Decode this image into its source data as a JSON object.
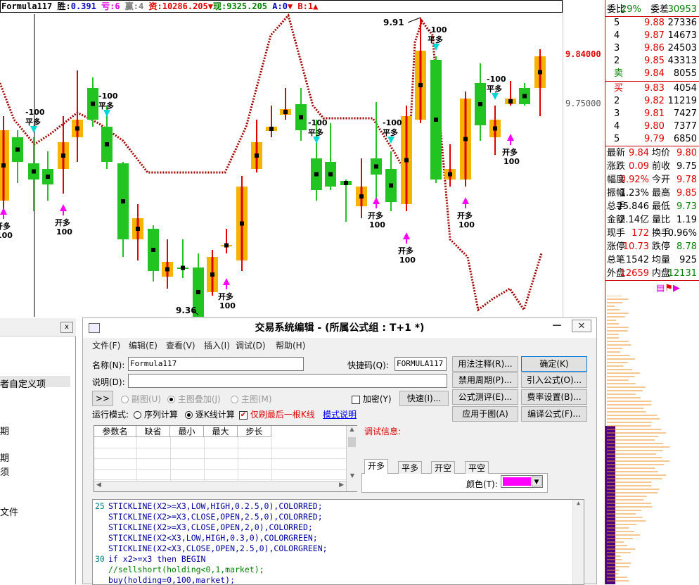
{
  "infobar": {
    "formula": "Formula117",
    "win_label": "胜:",
    "win_val": "0.391",
    "loss_label": "亏:",
    "loss_val": "6",
    "gain_label": "赢:",
    "gain_val": "4",
    "capital_label": "资:",
    "capital_val": "10286.205",
    "cash_label": "现:",
    "cash_val": "9325.205",
    "a_label": "A:",
    "a_val": "0",
    "b_label": "B:",
    "b_val": "1"
  },
  "chart": {
    "price_high_label": "9.84000",
    "price_mid_label": "9.75000",
    "peak_label": "9.91",
    "low_label": "9.36",
    "signals": [
      {
        "kind": "sell",
        "line1": "-100",
        "line2": "平多"
      },
      {
        "kind": "sell",
        "line1": "-100",
        "line2": "平多"
      },
      {
        "kind": "sell",
        "line1": "-100",
        "line2": "平多"
      },
      {
        "kind": "sell",
        "line1": "-100",
        "line2": "平多"
      },
      {
        "kind": "sell",
        "line1": "-100",
        "line2": "平多"
      },
      {
        "kind": "sell",
        "line1": "-100",
        "line2": "平多"
      },
      {
        "kind": "buy",
        "line1": "开多",
        "line2": "100"
      },
      {
        "kind": "buy",
        "line1": "开多",
        "line2": "100"
      },
      {
        "kind": "buy",
        "line1": "开多",
        "line2": "100"
      },
      {
        "kind": "buy",
        "line1": "开多",
        "line2": "100"
      },
      {
        "kind": "buy",
        "line1": "开多",
        "line2": "100"
      },
      {
        "kind": "buy",
        "line1": "开多",
        "line2": "100"
      },
      {
        "kind": "buy",
        "line1": "开多",
        "line2": "100"
      }
    ],
    "colors": {
      "up": "#f5b400",
      "up_line": "#e00000",
      "down": "#22c422",
      "stop_line": "#a00000",
      "buy": "#ff00ff",
      "sell": "#00d8d8"
    }
  },
  "quote": {
    "weibi_label": "委比",
    "weibi_val": "29%",
    "weicha_label": "委差",
    "weicha_val": "30953",
    "asks": [
      {
        "level": "5",
        "price": "9.88",
        "vol": "27336"
      },
      {
        "level": "4",
        "price": "9.87",
        "vol": "14673"
      },
      {
        "level": "3",
        "price": "9.86",
        "vol": "24503"
      },
      {
        "level": "2",
        "price": "9.85",
        "vol": "43313"
      },
      {
        "level": "卖",
        "price": "9.84",
        "vol": "8055"
      }
    ],
    "bids": [
      {
        "level": "买",
        "price": "9.83",
        "vol": "4054"
      },
      {
        "level": "2",
        "price": "9.82",
        "vol": "11219"
      },
      {
        "level": "3",
        "price": "9.81",
        "vol": "7427"
      },
      {
        "level": "4",
        "price": "9.80",
        "vol": "7377"
      },
      {
        "level": "5",
        "price": "9.79",
        "vol": "6850"
      }
    ],
    "stats": [
      {
        "l": "最新",
        "v": "9.84",
        "l2": "均价",
        "v2": "9.80"
      },
      {
        "l": "涨跌",
        "v": "0.09",
        "l2": "前收",
        "v2": "9.75"
      },
      {
        "l": "幅度",
        "v": "0.92%",
        "l2": "今开",
        "v2": "9.78"
      },
      {
        "l": "振幅",
        "v": "1.23%",
        "l2": "最高",
        "v2": "9.85"
      },
      {
        "l": "总手",
        "v": "25.846",
        "l2": "最低",
        "v2": "9.73"
      },
      {
        "l": "金额",
        "v": "2.14亿",
        "l2": "量比",
        "v2": "1.19"
      },
      {
        "l": "现手",
        "v": "172",
        "l2": "换手",
        "v2": "0.96%"
      },
      {
        "l": "涨停",
        "v": "10.73",
        "l2": "跌停",
        "v2": "8.78"
      },
      {
        "l": "总笔",
        "v": "1542",
        "l2": "均量",
        "v2": "925"
      },
      {
        "l": "外盘",
        "v": "12659",
        "l2": "内盘",
        "v2": "12131"
      }
    ]
  },
  "leftpanel": {
    "close": "x",
    "items": [
      "者自定义项",
      "期",
      "期",
      "须",
      "文件"
    ]
  },
  "dialog": {
    "title": "交易系统编辑 - (所属公式组 : T+1 *)",
    "menus": [
      "文件(F)",
      "编辑(E)",
      "查看(V)",
      "插入(I)",
      "调试(D)",
      "帮助(H)"
    ],
    "name_label": "名称(N):",
    "name_val": "Formula117",
    "shortcut_label": "快捷码(Q):",
    "shortcut_val": "FORMULA117",
    "desc_label": "说明(D):",
    "desc_val": "",
    "expand_btn": ">>",
    "radio_sub": "副图(U)",
    "radio_main_overlay": "主图叠加(J)",
    "radio_main": "主图(M)",
    "encrypt": "加密(Y)",
    "fast_btn": "快速(I)...",
    "runmode_label": "运行模式:",
    "run_seq": "序列计算",
    "run_step": "逐K线计算",
    "only_last": "仅刷最后一根K线",
    "mode_link": "模式说明",
    "debug_label": "调试信息:",
    "btns": [
      "用法注释(R)...",
      "确定(K)",
      "禁用周期(P)...",
      "引入公式(O)...",
      "公式测评(E)...",
      "费率设置(B)...",
      "应用于图(A)",
      "编译公式(F)..."
    ],
    "param_headers": [
      "参数名",
      "缺省",
      "最小",
      "最大",
      "步长"
    ],
    "tabs": [
      "开多",
      "平多",
      "开空",
      "平空"
    ],
    "color_label": "颜色(T):",
    "color_val": "#ff00ff",
    "code": [
      {
        "n": "25",
        "t": "STICKLINE(X2>=X3,LOW,HIGH,0.2.5,0),COLORRED;"
      },
      {
        "n": "",
        "t": "STICKLINE(X2>=X3,CLOSE,OPEN,2.5,0),COLORRED;"
      },
      {
        "n": "",
        "t": "STICKLINE(X2>=X3,CLOSE,OPEN,2,0),COLORRED;"
      },
      {
        "n": "",
        "t": "STICKLINE(X2<X3,LOW,HIGH,0.3,0),COLORGREEN;"
      },
      {
        "n": "",
        "t": "STICKLINE(X2<X3,CLOSE,OPEN,2.5,0),COLORGREEN;"
      },
      {
        "n": "30",
        "t": "if x2>=x3 then BEGIN"
      },
      {
        "n": "",
        "t": "//sellshort(holding<0,1,market);"
      },
      {
        "n": "",
        "t": "buy(holding=0,100,market);"
      }
    ]
  }
}
